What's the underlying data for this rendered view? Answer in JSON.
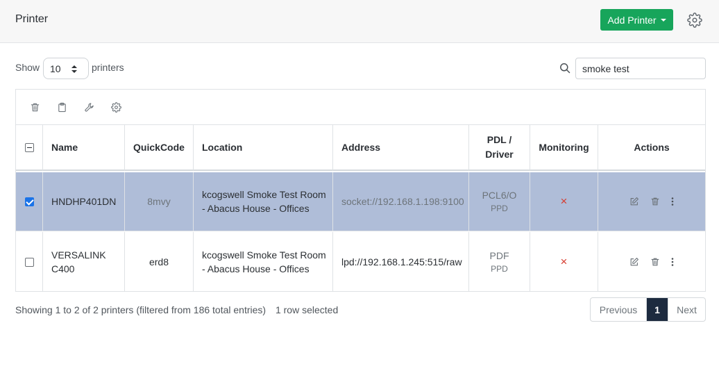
{
  "header": {
    "title": "Printer",
    "add_button": "Add Printer"
  },
  "controls": {
    "show_label": "Show",
    "page_length": "10",
    "printers_label": "printers",
    "search_value": "smoke test"
  },
  "table": {
    "columns": [
      "Name",
      "QuickCode",
      "Location",
      "Address",
      "PDL /\nDriver",
      "Monitoring",
      "Actions"
    ],
    "rows": [
      {
        "selected": true,
        "name": "HNDHP401DN",
        "quickcode": "8mvy",
        "location": "kcogswell Smoke Test Room - Abacus House - Offices",
        "address": "socket://192.168.1.198:9100",
        "pdl": "PCL6/O",
        "driver": "PPD",
        "monitoring": "×"
      },
      {
        "selected": false,
        "name": "VERSALINK C400",
        "quickcode": "erd8",
        "location": "kcogswell Smoke Test Room - Abacus House - Offices",
        "address": "lpd://192.168.1.245:515/raw",
        "pdl": "PDF",
        "driver": "PPD",
        "monitoring": "×"
      }
    ]
  },
  "footer": {
    "info": "Showing 1 to 2 of 2 printers (filtered from 186 total entries)",
    "selected_info": "1 row selected",
    "prev": "Previous",
    "page": "1",
    "next": "Next"
  },
  "colors": {
    "accent_green": "#17a55b",
    "selected_row": "#afbdd8",
    "monitor_red": "#d63b2f",
    "pager_active": "#1d2b3f"
  },
  "icons": {
    "toolbar": [
      "trash-icon",
      "clipboard-icon",
      "wrench-icon",
      "gear-icon"
    ],
    "row_actions": [
      "edit-icon",
      "trash-icon",
      "more-vertical-icon"
    ]
  }
}
